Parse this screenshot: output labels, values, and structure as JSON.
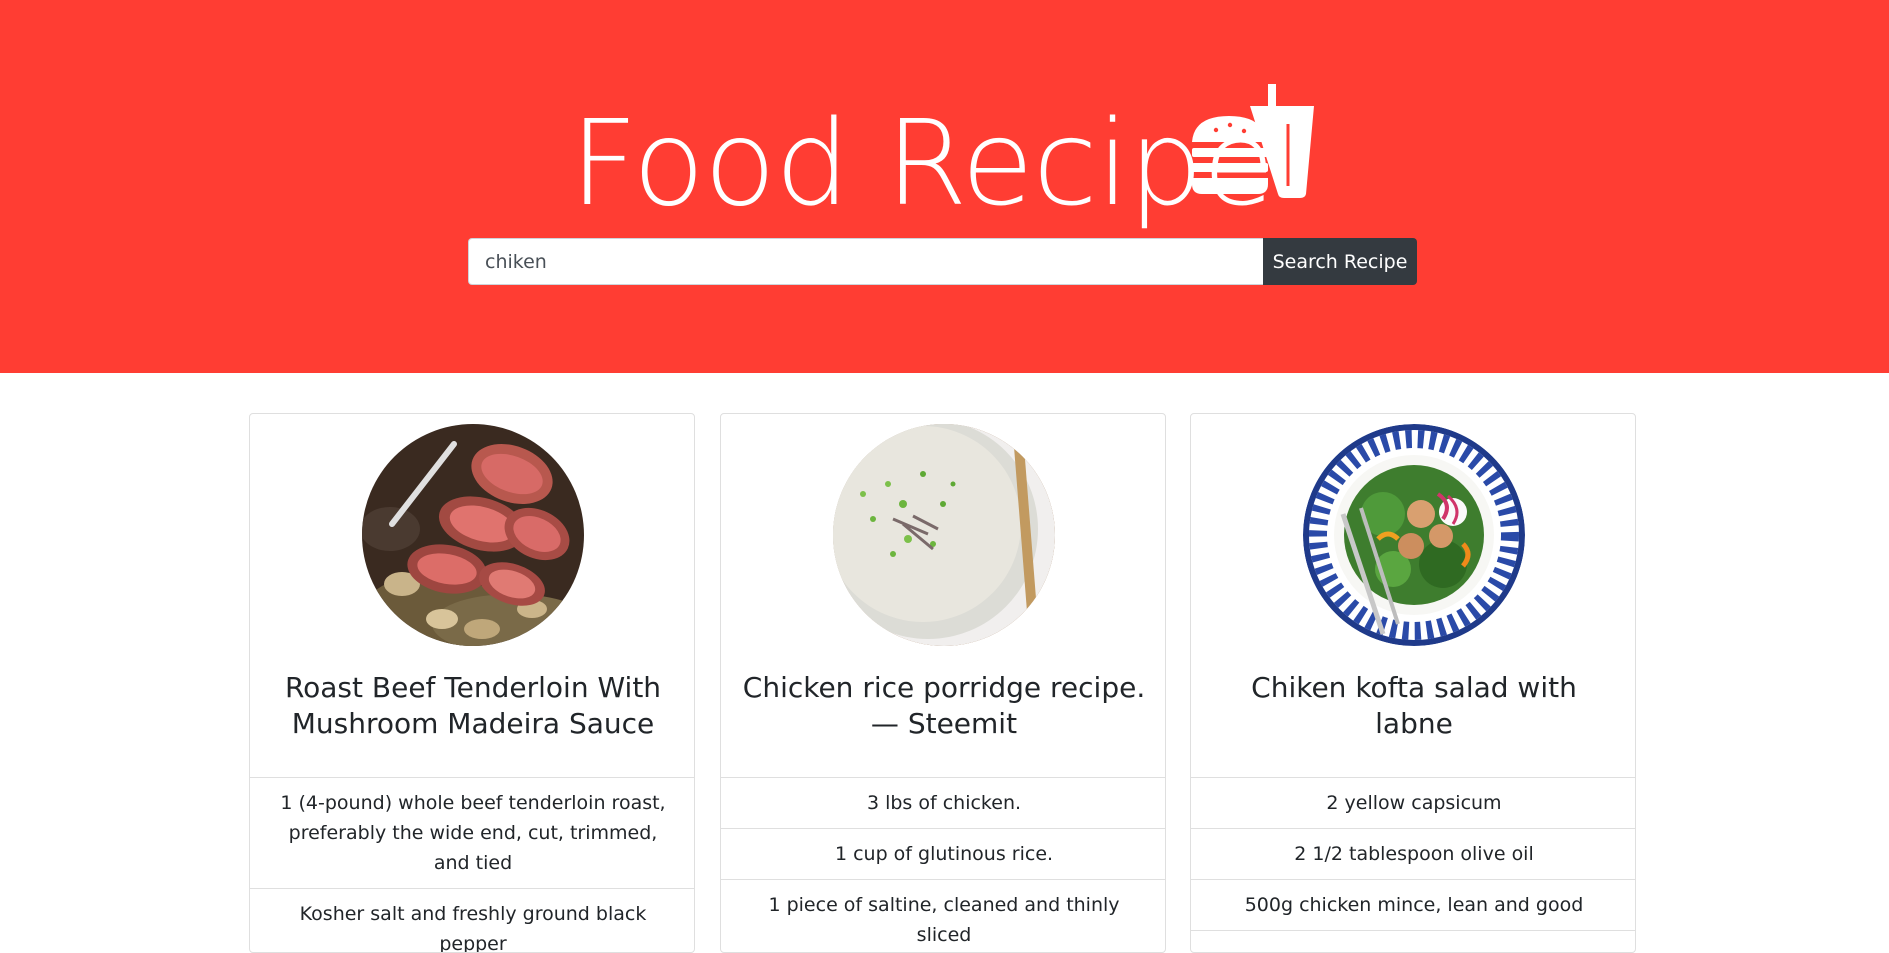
{
  "header": {
    "title": "Food Recipe",
    "logo_icon": "burger-and-drink-icon",
    "background": "#ff3d33"
  },
  "search": {
    "value": "chiken",
    "button_label": "Search Recipe"
  },
  "recipes": [
    {
      "title": "Roast Beef Tenderloin With Mushroom Madeira Sauce",
      "image": "roast-beef-photo",
      "ingredients": [
        "1 (4-pound) whole beef tenderloin roast, preferably the wide end, cut, trimmed, and tied",
        "Kosher salt and freshly ground black pepper"
      ]
    },
    {
      "title": "Chicken rice porridge recipe. — Steemit",
      "image": "rice-porridge-photo",
      "ingredients": [
        "3 lbs of chicken.",
        "1 cup of glutinous rice.",
        "1 piece of saltine, cleaned and thinly sliced"
      ]
    },
    {
      "title": "Chiken kofta salad with labne",
      "image": "kofta-salad-photo",
      "ingredients": [
        "2 yellow capsicum",
        "2 1/2 tablespoon olive oil",
        "500g chicken mince, lean and good"
      ]
    }
  ]
}
